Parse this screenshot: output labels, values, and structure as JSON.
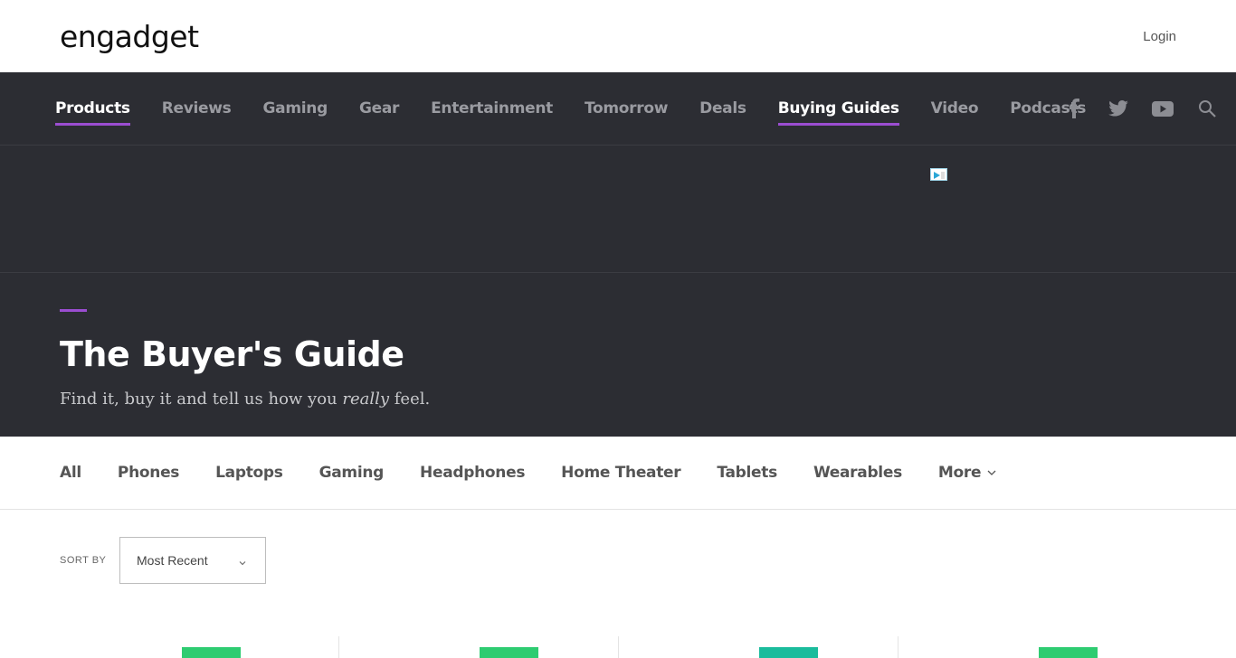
{
  "header": {
    "logo_text": "engadget",
    "login_label": "Login"
  },
  "nav": {
    "items": [
      {
        "label": "Products",
        "active": true
      },
      {
        "label": "Reviews",
        "active": false
      },
      {
        "label": "Gaming",
        "active": false
      },
      {
        "label": "Gear",
        "active": false
      },
      {
        "label": "Entertainment",
        "active": false
      },
      {
        "label": "Tomorrow",
        "active": false
      },
      {
        "label": "Deals",
        "active": false
      },
      {
        "label": "Buying Guides",
        "active": true
      },
      {
        "label": "Video",
        "active": false
      },
      {
        "label": "Podcasts",
        "active": false
      }
    ],
    "social_icons": [
      "facebook-icon",
      "twitter-icon",
      "youtube-icon",
      "search-icon"
    ]
  },
  "hero": {
    "title": "The Buyer's Guide",
    "subtitle_before": "Find it, buy it and tell us how you ",
    "subtitle_emphasis": "really",
    "subtitle_after": " feel."
  },
  "categories": {
    "items": [
      "All",
      "Phones",
      "Laptops",
      "Gaming",
      "Headphones",
      "Home Theater",
      "Tablets",
      "Wearables",
      "More"
    ]
  },
  "sort": {
    "label": "SORT BY",
    "value": "Most Recent"
  },
  "cards": [
    {
      "score_color": "#2ecc71"
    },
    {
      "score_color": "#2ecc71"
    },
    {
      "score_color": "#1abc9c"
    },
    {
      "score_color": "#2ecc71"
    }
  ],
  "colors": {
    "dark_bg": "#2c2d33",
    "accent": "#9b4dd1"
  }
}
